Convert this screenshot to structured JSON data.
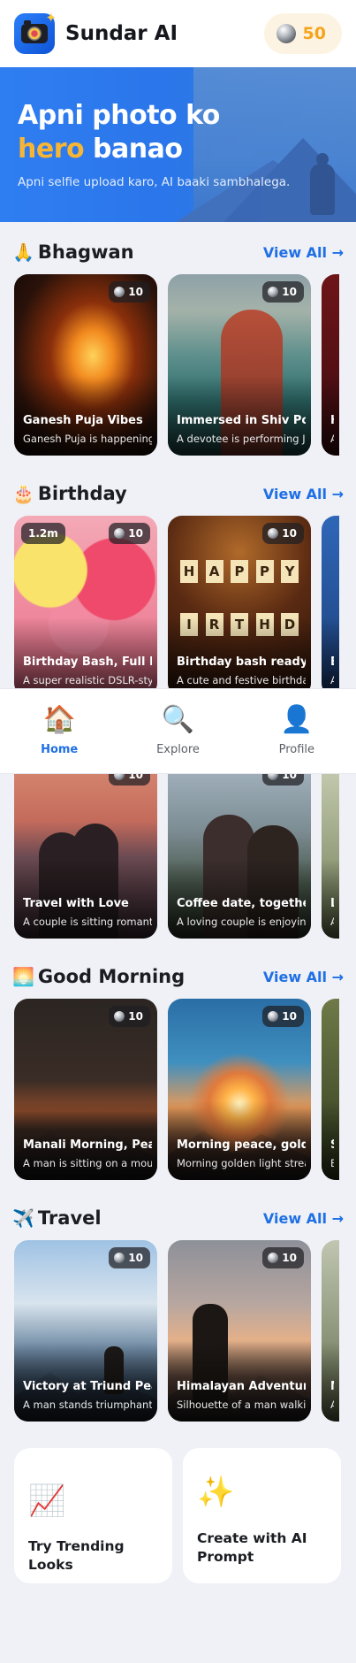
{
  "header": {
    "app_name": "Sundar AI",
    "coin_balance": "50"
  },
  "hero": {
    "title_line1": "Apni photo ko",
    "title_highlight": "hero",
    "title_rest": " banao",
    "subtitle": "Apni selfie upload karo, AI baaki sambhalega."
  },
  "sections": {
    "bhagwan": {
      "emoji": "🙏",
      "title": "Bhagwan",
      "view_all": "View All →",
      "cards": [
        {
          "title": "Ganesh Puja Vibes",
          "desc": "Ganesh Puja is happening",
          "price": "10"
        },
        {
          "title": "Immersed in Shiv Poo",
          "desc": "A devotee is performing Je",
          "price": "10"
        },
        {
          "title": "H",
          "desc": "A"
        }
      ]
    },
    "birthday": {
      "emoji": "🎂",
      "title": "Birthday",
      "view_all": "View All →",
      "cards": [
        {
          "title": "Birthday Bash, Full Fu",
          "desc": "A super realistic DSLR-style",
          "price": "10",
          "tag": "1.2m"
        },
        {
          "title": "Birthday bash ready,",
          "desc": "A cute and festive birthda",
          "price": "10",
          "banner_letters": [
            "H",
            "A",
            "P",
            "P",
            "Y"
          ],
          "banner_letters2": [
            "I",
            "R",
            "T",
            "H",
            "D"
          ]
        },
        {
          "title": "Bi",
          "desc": "A"
        }
      ]
    },
    "love": {
      "cards": [
        {
          "title": "Travel with Love",
          "desc": "A couple is sitting romanti",
          "price": "10"
        },
        {
          "title": "Coffee date, together",
          "desc": "A loving couple is enjoying",
          "price": "10"
        },
        {
          "title": "Lo",
          "desc": "A"
        }
      ]
    },
    "good_morning": {
      "emoji": "🌅",
      "title": "Good Morning",
      "view_all": "View All →",
      "cards": [
        {
          "title": "Manali Morning, Peac",
          "desc": "A man is sitting on a moun",
          "price": "10"
        },
        {
          "title": "Morning peace, golde",
          "desc": "Morning golden light strea",
          "price": "10"
        },
        {
          "title": "Su",
          "desc": "Be"
        }
      ]
    },
    "travel": {
      "emoji": "✈️",
      "title": "Travel",
      "view_all": "View All →",
      "cards": [
        {
          "title": "Victory at Triund Peal",
          "desc": "A man stands triumphant",
          "price": "10"
        },
        {
          "title": "Himalayan Adventure",
          "desc": "Silhouette of a man walkin",
          "price": "10"
        },
        {
          "title": "M",
          "desc": "A"
        }
      ]
    }
  },
  "bottom_nav": [
    {
      "icon": "🏠",
      "label": "Home",
      "active": true
    },
    {
      "icon": "🔍",
      "label": "Explore",
      "active": false
    },
    {
      "icon": "👤",
      "label": "Profile",
      "active": false
    }
  ],
  "tiles": [
    {
      "icon": "📈",
      "label": "Try Trending Looks"
    },
    {
      "icon": "✨",
      "label": "Create with AI Prompt"
    }
  ],
  "colors": {
    "accent_blue": "#1f6fe5",
    "hero_highlight": "#f7b535",
    "coin_text": "#f4a41d"
  }
}
